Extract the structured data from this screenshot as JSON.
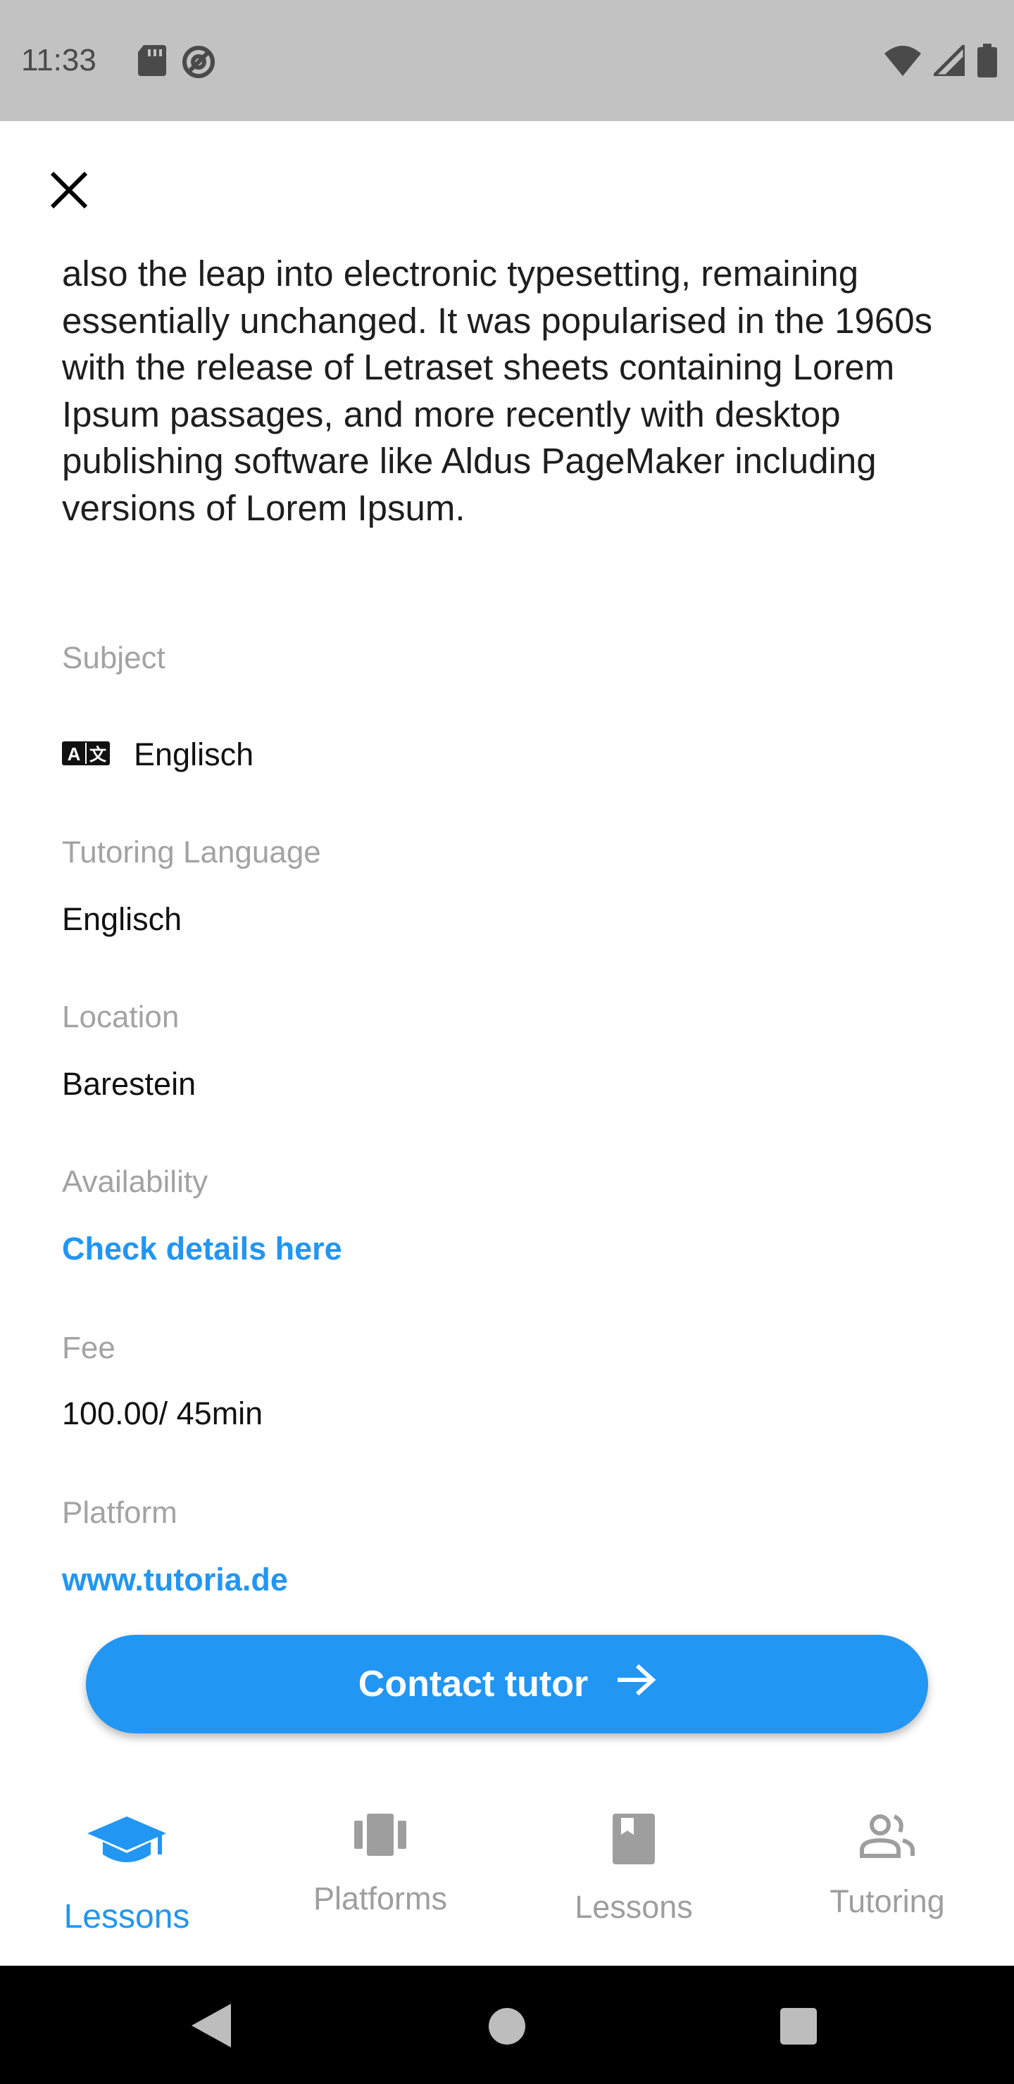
{
  "status_bar": {
    "time": "11:33",
    "icons_left": [
      "sd-card-icon",
      "at-sign-icon"
    ],
    "icons_right": [
      "wifi-icon",
      "cell-signal-icon",
      "battery-icon"
    ]
  },
  "header": {
    "close_icon": "close-icon"
  },
  "description": "also the leap into electronic typesetting, remaining essentially unchanged. It was popularised in the 1960s with the release of Letraset sheets containing Lorem Ipsum passages, and more recently with desktop publishing software like Aldus PageMaker including versions of Lorem Ipsum.",
  "details": {
    "subject_label": "Subject",
    "subject_value": "Englisch",
    "subject_icon": "translate-icon",
    "language_label": "Tutoring Language",
    "language_value": "Englisch",
    "location_label": "Location",
    "location_value": "Barestein",
    "availability_label": "Availability",
    "availability_link": "Check details here",
    "fee_label": "Fee",
    "fee_value": "100.00/ 45min",
    "platform_label": "Platform",
    "platform_link": "www.tutoria.de"
  },
  "contact_button": {
    "label": "Contact tutor",
    "icon": "arrow-right-icon"
  },
  "bottom_nav": [
    {
      "label": "Lessons",
      "icon": "graduation-cap-icon",
      "active": true
    },
    {
      "label": "Platforms",
      "icon": "carousel-icon",
      "active": false
    },
    {
      "label": "Lessons",
      "icon": "book-icon",
      "active": false
    },
    {
      "label": "Tutoring",
      "icon": "people-icon",
      "active": false
    }
  ],
  "colors": {
    "accent": "#2196f3",
    "label_gray": "#a3a3a3",
    "status_bar_bg": "#c2c2c2",
    "system_nav_bg": "#000000"
  }
}
